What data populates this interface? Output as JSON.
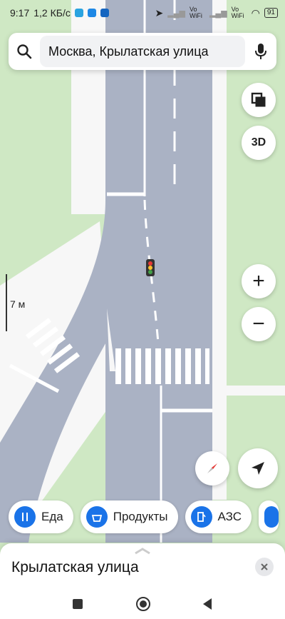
{
  "status": {
    "time": "9:17",
    "speed": "1,2 КБ/с",
    "net1": "Vo WiFi",
    "net2": "Vo WiFi",
    "battery": "91"
  },
  "search": {
    "value": "Москва, Крылатская улица"
  },
  "controls": {
    "layers_icon": "layers-icon",
    "btn_3d": "3D",
    "zoom_in": "+",
    "zoom_out": "−"
  },
  "scale": {
    "label": "7 м"
  },
  "chips": [
    {
      "label": "Еда",
      "icon": "fork-knife-icon"
    },
    {
      "label": "Продукты",
      "icon": "basket-icon"
    },
    {
      "label": "АЗС",
      "icon": "fuel-pump-icon"
    }
  ],
  "sheet": {
    "title": "Крылатская улица"
  },
  "colors": {
    "road": "#aab2c4",
    "grass": "#cfe8c4",
    "sidewalk": "#f7f7f7",
    "accent": "#1a73e8"
  }
}
